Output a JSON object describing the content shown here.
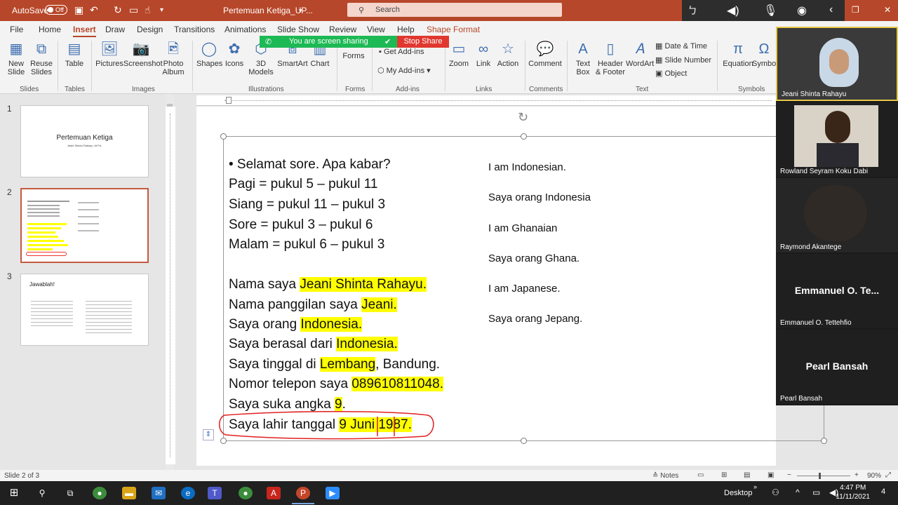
{
  "titlebar": {
    "autosave_label": "AutoSave",
    "autosave_state": "Off",
    "doc_title": "Pertemuan Ketiga_UP...",
    "search_placeholder": "Search"
  },
  "menu": {
    "items": [
      "File",
      "Home",
      "Insert",
      "Draw",
      "Design",
      "Transitions",
      "Animations",
      "Slide Show",
      "Review",
      "View",
      "Help",
      "Shape Format"
    ],
    "active": "Insert"
  },
  "sharing": {
    "banner": "You are screen sharing",
    "stop_label": "Stop Share"
  },
  "ribbon": {
    "new_slide": "New Slide",
    "reuse_slides": "Reuse Slides",
    "table": "Table",
    "pictures": "Pictures",
    "screenshot": "Screenshot",
    "photo_album": "Photo Album",
    "shapes": "Shapes",
    "icons": "Icons",
    "models_3d": "3D Models",
    "smartart": "SmartArt",
    "chart": "Chart",
    "forms": "Forms",
    "get_addins": "Get Add-ins",
    "my_addins": "My Add-ins",
    "zoom": "Zoom",
    "link": "Link",
    "action": "Action",
    "comment": "Comment",
    "text_box": "Text Box",
    "header_footer": "Header & Footer",
    "wordart": "WordArt",
    "date_time": "Date & Time",
    "slide_number": "Slide Number",
    "object": "Object",
    "equation": "Equation",
    "symbol": "Symbo",
    "groups": {
      "slides": "Slides",
      "tables": "Tables",
      "images": "Images",
      "illustrations": "Illustrations",
      "forms": "Forms",
      "addins": "Add-ins",
      "links": "Links",
      "comments": "Comments",
      "text": "Text",
      "symbols": "Symbols"
    }
  },
  "thumbnails": {
    "slide1_num": "1",
    "slide1_title": "Pertemuan Ketiga",
    "slide1_sub": "Jeani Shinta Rahayu, M.Pd.",
    "slide2_num": "2",
    "slide3_num": "3",
    "slide3_title": "Jawablah!"
  },
  "slide": {
    "left_lines": [
      "•  Selamat sore. Apa kabar?",
      "Pagi = pukul 5 – pukul 11",
      "Siang =  pukul 11 – pukul 3",
      "Sore =  pukul 3 – pukul 6",
      "Malam = pukul 6 – pukul 3"
    ],
    "intro": [
      {
        "pre": "Nama saya ",
        "hl": "Jeani Shinta Rahayu.",
        "post": ""
      },
      {
        "pre": "Nama panggilan saya ",
        "hl": "Jeani.",
        "post": ""
      },
      {
        "pre": "Saya orang ",
        "hl": "Indonesia.",
        "post": ""
      },
      {
        "pre": "Saya berasal dari ",
        "hl": "Indonesia.",
        "post": ""
      },
      {
        "pre": "Saya tinggal di ",
        "hl": "Lembang",
        "post": ", Bandung."
      },
      {
        "pre": "Nomor telepon saya ",
        "hl": "089610811048.",
        "post": ""
      },
      {
        "pre": "Saya suka angka ",
        "hl": "9",
        "post": "."
      },
      {
        "pre": "Saya lahir tanggal ",
        "hl": "9 Juni 1987.",
        "post": ""
      }
    ],
    "right_lines": [
      "I am Indonesian.",
      "Saya orang Indonesia",
      "I am Ghanaian",
      "Saya orang Ghana.",
      "I am Japanese.",
      "Saya orang Jepang."
    ]
  },
  "participants": [
    {
      "name": "Jeani Shinta Rahayu",
      "video": true
    },
    {
      "name": "Rowland Seyram Koku Dabi",
      "video": true
    },
    {
      "name": "Raymond Akantege",
      "video": true
    },
    {
      "name": "Emmanuel O. Tettehfio",
      "display": "Emmanuel  O.  Te...",
      "video": false
    },
    {
      "name": "Pearl Bansah",
      "display": "Pearl Bansah",
      "video": false
    }
  ],
  "status": {
    "slide_info": "Slide 2 of 3",
    "notes": "Notes",
    "zoom": "90%"
  },
  "taskbar": {
    "desktop": "Desktop",
    "time": "4:47 PM",
    "date": "11/11/2021",
    "notif": "4"
  },
  "colors": {
    "accent": "#b7472a",
    "highlight": "#ffff00",
    "share_green": "#1db954",
    "stop_red": "#e0382f"
  }
}
